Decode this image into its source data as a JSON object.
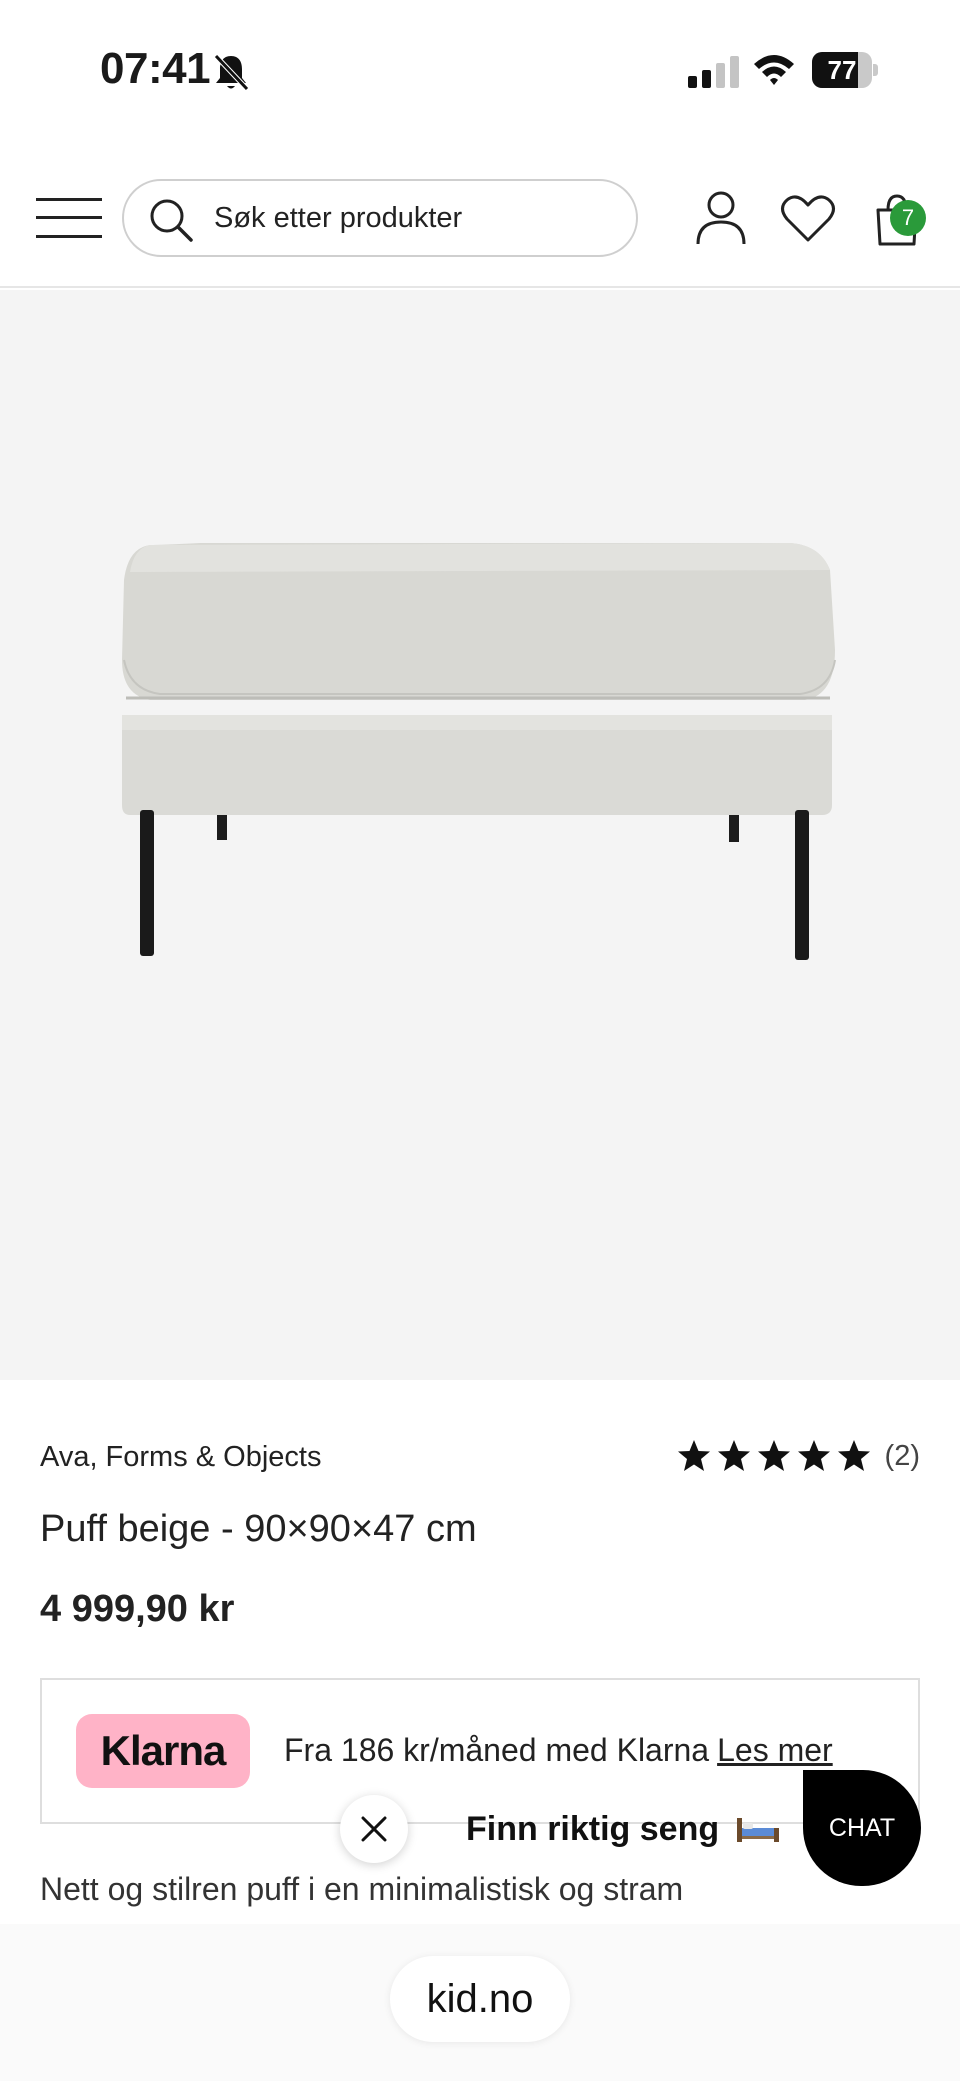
{
  "status_bar": {
    "time": "07:41",
    "battery": "77",
    "battery_level": 0.77
  },
  "header": {
    "search": {
      "placeholder": "Søk etter produkter"
    },
    "cart_count": "7"
  },
  "product": {
    "brand": "Ava, Forms & Objects",
    "rating_stars": 5,
    "rating_count": "(2)",
    "title": "Puff beige - 90×90×47 cm",
    "price": "4 999,90 kr",
    "description": "Nett og stilren puff i en minimalistisk og stram"
  },
  "klarna": {
    "logo": "Klarna",
    "text": "Fra 186 kr/måned med Klarna",
    "link": "Les mer"
  },
  "promo": {
    "text": "Finn riktig seng"
  },
  "chat": {
    "label": "CHAT"
  },
  "browser": {
    "url": "kid.no"
  },
  "colors": {
    "badge": "#2a9a3a",
    "klarna_pink": "#ffb3c7",
    "image_bg": "#f4f4f4"
  }
}
